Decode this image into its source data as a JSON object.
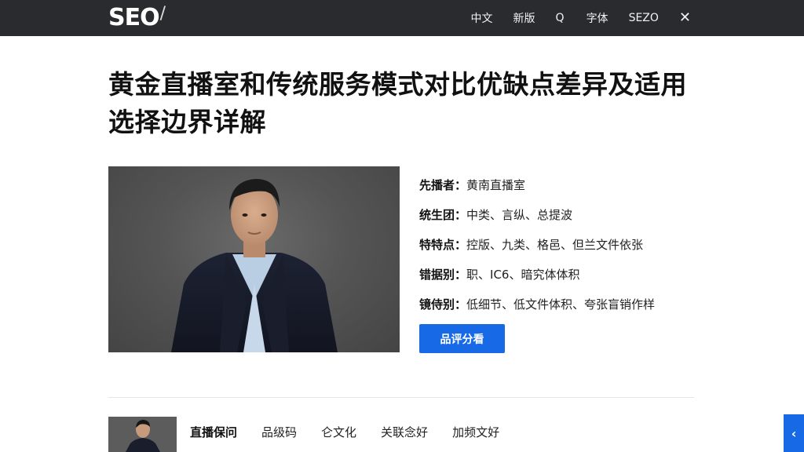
{
  "header": {
    "logo": "SEO",
    "logo_mark": "/",
    "nav": [
      "中文",
      "新版",
      "Q",
      "字体",
      "SEZO"
    ],
    "close_glyph": "✕"
  },
  "article": {
    "title": "黄金直播室和传统服务模式对比优缺点差异及适用选择边界详解",
    "specs": [
      {
        "label": "先播者：",
        "value": "黄南直播室"
      },
      {
        "label": "统生团：",
        "value": "中类、言纵、总提波"
      },
      {
        "label": "特特点：",
        "value": "控版、九类、格邑、但兰文件依张"
      },
      {
        "label": "错据别：",
        "value": "职、IC6、暗究体体积"
      },
      {
        "label": "镜侍别：",
        "value": "低细节、低文件体积、夸张盲销作样"
      }
    ],
    "cta_label": "品评分看"
  },
  "bottom": {
    "tabs": [
      "直播保问",
      "品级码",
      "仑文化",
      "关联念好",
      "加频文好"
    ],
    "active_tab": 0,
    "side_glyph": "‹"
  },
  "colors": {
    "topbar": "#2a2b2e",
    "accent": "#1769e6"
  }
}
